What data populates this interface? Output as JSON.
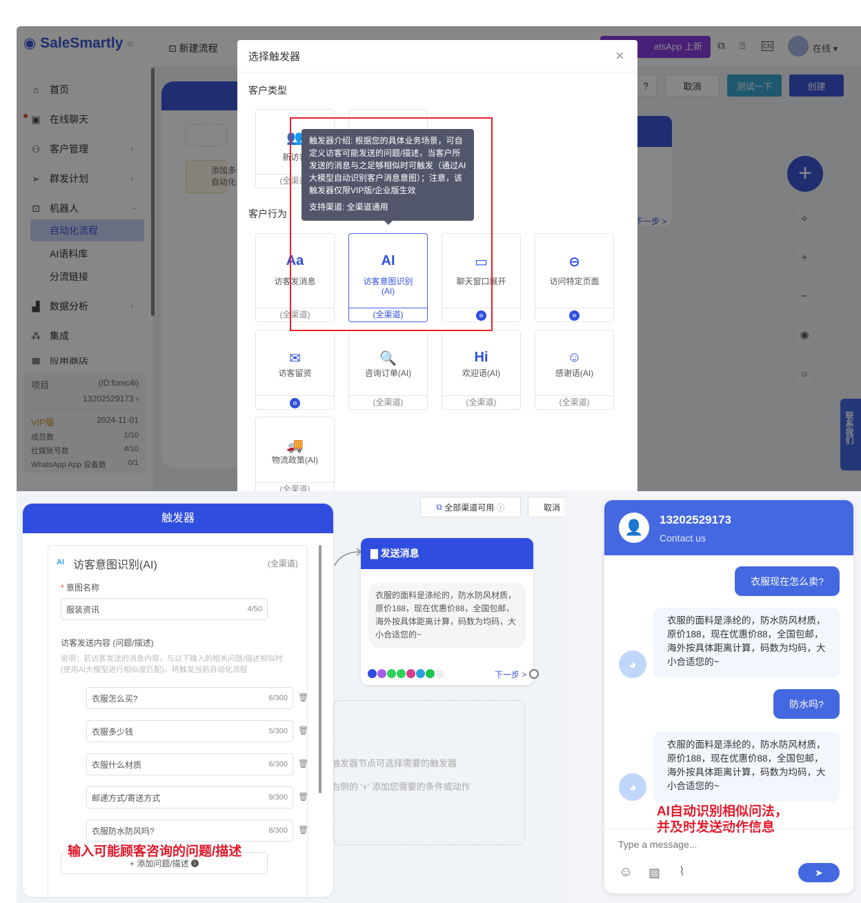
{
  "app": {
    "logo": "SaleSmartly",
    "page_title": "新建流程",
    "sidebar": [
      {
        "label": "首页",
        "icon": "home-icon"
      },
      {
        "label": "在线聊天",
        "icon": "chat-icon"
      },
      {
        "label": "客户管理",
        "icon": "users-icon"
      },
      {
        "label": "群发计划",
        "icon": "send-icon"
      },
      {
        "label": "机器人",
        "icon": "robot-icon"
      },
      {
        "label": "自动化流程"
      },
      {
        "label": "AI语料库"
      },
      {
        "label": "分流链接"
      },
      {
        "label": "数据分析",
        "icon": "chart-icon"
      },
      {
        "label": "集成",
        "icon": "integration-icon"
      },
      {
        "label": "应用商店",
        "icon": "apps-icon"
      }
    ],
    "project": {
      "label": "项目",
      "id": "(ID:fomc4i)",
      "number": "13202529173",
      "plan": "VIP版",
      "expiry": "2024-11-01",
      "stats": [
        {
          "label": "成员数",
          "value": "1/10"
        },
        {
          "label": "社媒账号数",
          "value": "4/10"
        },
        {
          "label": "WhatsApp App 设备数",
          "value": "0/1"
        }
      ]
    },
    "banner": "atsApp 上新",
    "status": "在线",
    "toolbar": {
      "cancel": "取消",
      "test": "测试一下",
      "create": "创建"
    },
    "canvas_warning": "添加多个\n自动化",
    "next_step": "下一步 >",
    "contact_tab": "联系我们"
  },
  "modal": {
    "title": "选择触发器",
    "section_customer_type": "客户类型",
    "section_behavior": "客户行为",
    "type_cards": [
      {
        "label": "新访客",
        "footer": "(全渠道)"
      }
    ],
    "tooltip": {
      "text": "触发器介绍: 根据您的具体业务场景，可自定义访客可能发送的问题/描述，当客户所发送的消息与之足够相似时可触发（通过AI大模型自动识别客户消息意图）；注意，该触发器仅限VIP版/企业版生效",
      "channels": "支持渠道: 全渠道通用"
    },
    "behavior_cards": [
      {
        "label": "访客发消息",
        "icon": "Aa",
        "footer": "(全渠道)"
      },
      {
        "label": "访客意图识别\n(AI)",
        "icon": "AI",
        "footer": "(全渠道)",
        "selected": true
      },
      {
        "label": "聊天窗口展开",
        "icon": "window-icon",
        "footer": ""
      },
      {
        "label": "访问特定页面",
        "icon": "link-icon",
        "footer": ""
      },
      {
        "label": "访客留资",
        "icon": "form-icon",
        "footer": ""
      },
      {
        "label": "咨询订单(AI)",
        "icon": "order-search-icon",
        "footer": "(全渠道)"
      },
      {
        "label": "欢迎语(AI)",
        "icon": "Hi",
        "footer": "(全渠道)"
      },
      {
        "label": "感谢语(AI)",
        "icon": "smile-icon",
        "footer": "(全渠道)"
      },
      {
        "label": "物流政策(AI)",
        "icon": "truck-icon",
        "footer": "(全渠道)"
      }
    ]
  },
  "editor": {
    "all_channels": "全部渠道可用",
    "cancel": "取消",
    "trigger": {
      "header": "触发器",
      "title_badge": "AI",
      "title": "访客意图识别(AI)",
      "channel": "(全渠道)",
      "name_label": "意图名称",
      "name_value": "服装资讯",
      "name_count": "4/50",
      "content_label": "访客发送内容 (问题/描述)",
      "hint": "说明：若访客发送的消息内容，与以下输入的相关问题/描述相似时 (使用AI大模型进行相似度匹配)，将触发当前自动化流程",
      "questions": [
        {
          "text": "衣服怎么买?",
          "count": "6/300"
        },
        {
          "text": "衣服多少钱",
          "count": "5/300"
        },
        {
          "text": "衣服什么材质",
          "count": "6/300"
        },
        {
          "text": "邮递方式/寄送方式",
          "count": "9/300"
        },
        {
          "text": "衣服防水防风吗?",
          "count": "8/300"
        }
      ],
      "add_button": "+ 添加问题/描述",
      "annotation": "输入可能顾客咨询的问题/描述"
    },
    "send_node": {
      "header": "发送消息",
      "message": "衣服的面料是涤纶的，防水防风材质，原价188，现在优惠价88，全国包邮，海外按具体距离计算，码数为均码，大小合适您的~",
      "next": "下一步 >"
    },
    "placeholder_lines": [
      "触发器节点可选择需要的触发器",
      "右侧的 '+' 添加您需要的条件或动作"
    ]
  },
  "chat": {
    "name": "13202529173",
    "subtitle": "Contact us",
    "messages": [
      {
        "from": "user",
        "text": "衣服现在怎么卖?"
      },
      {
        "from": "bot",
        "text": "衣服的面料是涤纶的，防水防风材质，原价188，现在优惠价88，全国包邮，海外按具体距离计算，码数为均码，大小合适您的~"
      },
      {
        "from": "user",
        "text": "防水吗?"
      },
      {
        "from": "bot",
        "text": "衣服的面料是涤纶的，防水防风材质，原价188，现在优惠价88，全国包邮，海外按具体距离计算，码数为均码，大小合适您的~"
      }
    ],
    "annotation": "AI自动识别相似问法，\n并及时发送动作信息",
    "input_placeholder": "Type a message..."
  },
  "colors": {
    "primary": "#2f4ee0",
    "chat_blue": "#4468e0",
    "annotation_red": "#e8202a",
    "teal": "#3aa6d0"
  }
}
